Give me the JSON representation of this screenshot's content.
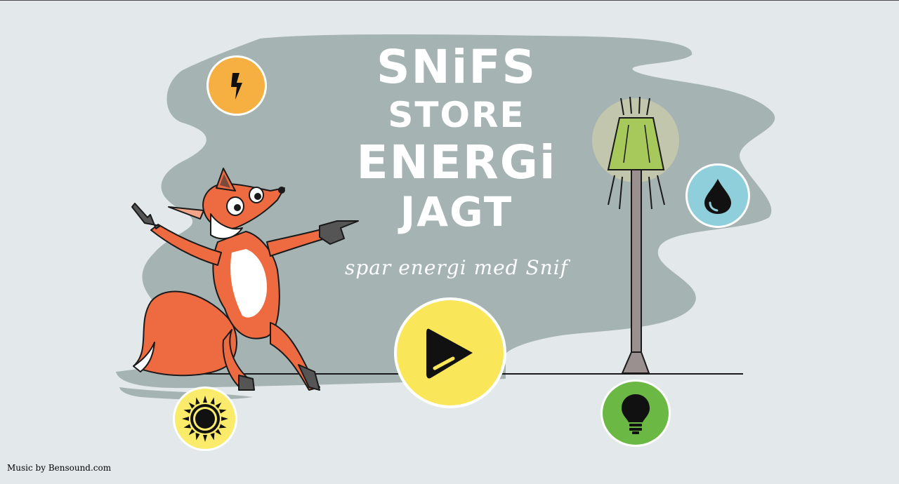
{
  "game": {
    "title_lines": [
      "SNiFS",
      "STORE",
      "ENERGi",
      "JAGT"
    ],
    "subtitle": "spar energi med Snif"
  },
  "buttons": {
    "play_icon": "play-icon"
  },
  "icons": [
    "bolt-icon",
    "drop-icon",
    "sun-icon",
    "bulb-icon"
  ],
  "footer": {
    "credit": "Music by Bensound.com"
  },
  "colors": {
    "background": "#e3e9ea",
    "smoke": "#a6b3b3",
    "bolt_bg": "#f6b042",
    "drop_bg": "#8fcfdc",
    "sun_bg": "#faec6a",
    "bulb_bg": "#6bb944",
    "play_bg": "#fae759",
    "fox": "#ee6b42",
    "lamp_shade": "#a7c95c"
  }
}
